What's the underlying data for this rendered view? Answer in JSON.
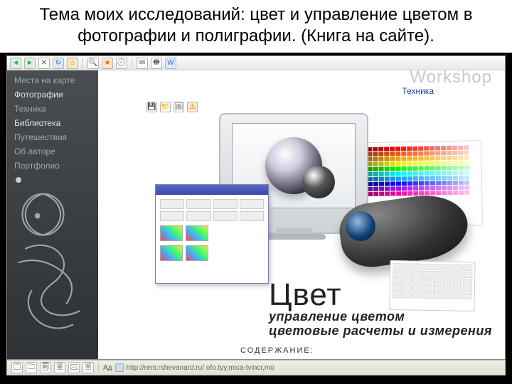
{
  "slide": {
    "title": "Тема моих исследований: цвет и управление цветом в фотографии и полиграфии. (Книга на сайте)."
  },
  "header": {
    "workshop_label": "Workshop",
    "breadcrumb": "Техника"
  },
  "sidebar": {
    "items": [
      {
        "label": "Места на карте"
      },
      {
        "label": "Фотографии"
      },
      {
        "label": "Техника"
      },
      {
        "label": "Библиотека"
      },
      {
        "label": "Путешествия"
      },
      {
        "label": "Об авторе"
      },
      {
        "label": "Портфолио"
      }
    ]
  },
  "book": {
    "title_big": "Цвет",
    "line1": "управление цветом",
    "line2": "цветовые расчеты и измерения"
  },
  "contents_label": "СОДЕРЖАНИЕ:",
  "address_bar": {
    "prefix": "Ад",
    "url": "http://rent.rshevanard.ru/ ofo.tyy,mica-tvincr,mo"
  },
  "icons": {
    "back": "back-icon",
    "forward": "forward-icon",
    "stop": "stop-icon",
    "refresh": "refresh-icon",
    "home": "home-icon",
    "search": "search-icon",
    "favorites": "favorites-icon",
    "history": "history-icon",
    "mail": "mail-icon",
    "print": "print-icon",
    "word": "word-icon",
    "save": "save-icon",
    "folder": "folder-icon",
    "img": "image-icon",
    "warn": "warn-icon"
  },
  "colors": {
    "sidebar_bg": "#3c3f44",
    "accent_blue": "#3c4aa8"
  }
}
